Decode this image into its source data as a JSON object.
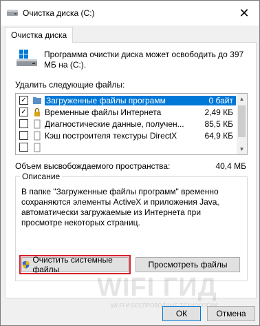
{
  "window": {
    "title": "Очистка диска  (C:)",
    "close_glyph": "✕"
  },
  "tab": {
    "label": "Очистка диска"
  },
  "intro": {
    "text": "Программа очистки диска может освободить до 397 МБ на  (C:)."
  },
  "files": {
    "label": "Удалить следующие файлы:",
    "rows": [
      {
        "name": "Загруженные файлы программ",
        "size": "0 байт",
        "checked": true,
        "selected": true,
        "icon": "folder-icon"
      },
      {
        "name": "Временные файлы Интернета",
        "size": "2,49 КБ",
        "checked": true,
        "selected": false,
        "icon": "lock-icon"
      },
      {
        "name": "Диагностические данные, получен...",
        "size": "85,5 КБ",
        "checked": false,
        "selected": false,
        "icon": "file-icon"
      },
      {
        "name": "Кэш построителя текстуры DirectX",
        "size": "64,9 КБ",
        "checked": false,
        "selected": false,
        "icon": "file-icon"
      },
      {
        "name": "",
        "size": "",
        "checked": false,
        "selected": false,
        "icon": "file-icon"
      }
    ]
  },
  "space": {
    "label": "Объем высвобождаемого пространства:",
    "value": "40,4 МБ"
  },
  "description": {
    "legend": "Описание",
    "text": "В папке \"Загруженные файлы программ\" временно сохраняются элементы ActiveX и приложения Java, автоматически загружаемые из Интернета при просмотре некоторых страниц."
  },
  "buttons": {
    "cleanup_system": "Очистить системные файлы",
    "view_files": "Просмотреть файлы",
    "ok": "ОК",
    "cancel": "Отмена"
  },
  "watermark": {
    "text": "WIFI ГИД",
    "sub": "WI-FI И БЕСПРОВОДНЫЕ ТЕХНОЛОГИИ"
  },
  "colors": {
    "selection": "#0078d7",
    "highlight_frame": "#d81e2c"
  }
}
